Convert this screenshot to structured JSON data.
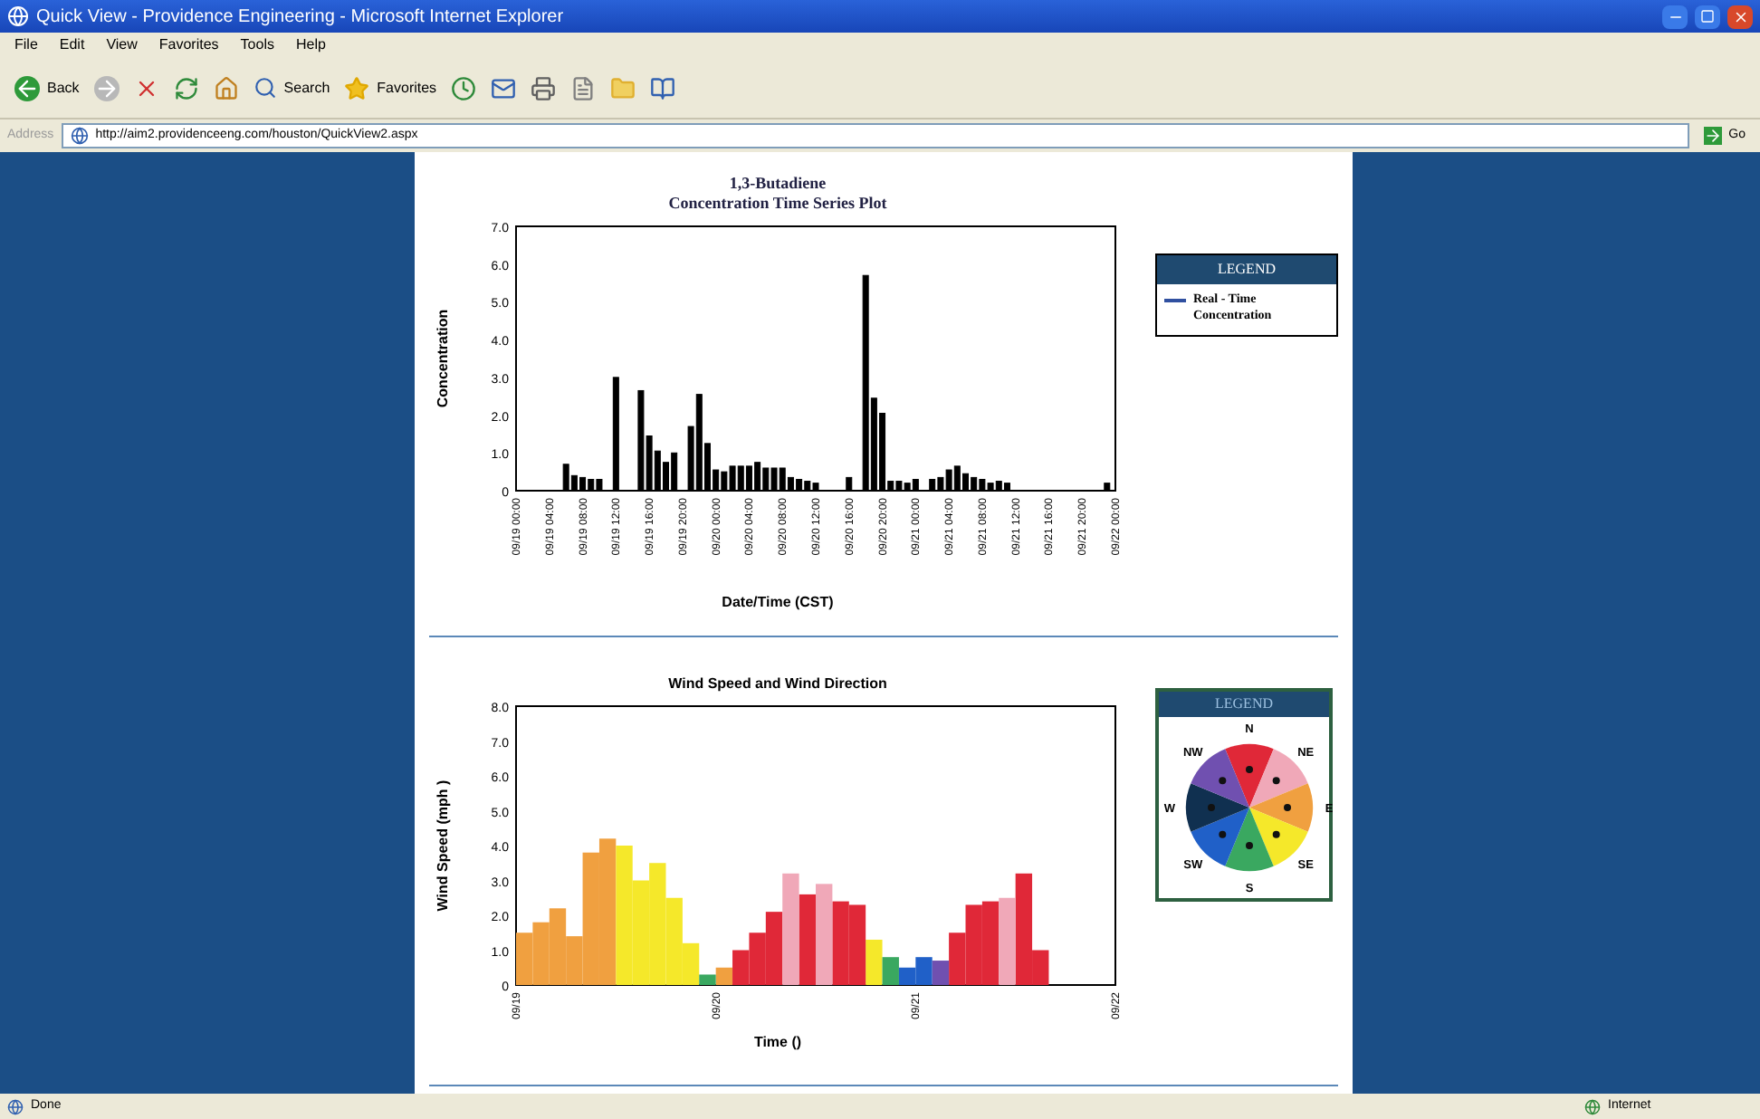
{
  "window": {
    "title": "Quick View - Providence Engineering - Microsoft Internet Explorer"
  },
  "menu": [
    "File",
    "Edit",
    "View",
    "Favorites",
    "Tools",
    "Help"
  ],
  "toolbar": {
    "back": "Back",
    "search": "Search",
    "favorites": "Favorites"
  },
  "address_bar": {
    "label": "Address",
    "value": "http://aim2.providenceeng.com/houston/QuickView2.aspx",
    "go": "Go"
  },
  "concentration_plot": {
    "title": "1,3-Butadiene",
    "subtitle": "Concentration Time Series Plot",
    "legend": {
      "header": "LEGEND",
      "items": [
        {
          "label": "Real - Time Concentration",
          "color": "#3050a0"
        }
      ]
    },
    "chart_data": {
      "type": "bar",
      "xlabel": "Date/Time (CST)",
      "ylabel": "Concentration",
      "categories": [
        "09/19 00:00",
        null,
        null,
        null,
        "09/19 04:00",
        null,
        null,
        null,
        "09/19 08:00",
        null,
        null,
        null,
        "09/19 12:00",
        null,
        null,
        null,
        "09/19 16:00",
        null,
        null,
        null,
        "09/19 20:00",
        null,
        null,
        null,
        "09/20 00:00",
        null,
        null,
        null,
        "09/20 04:00",
        null,
        null,
        null,
        "09/20 08:00",
        null,
        null,
        null,
        "09/20 12:00",
        null,
        null,
        null,
        "09/20 16:00",
        null,
        null,
        null,
        "09/20 20:00",
        null,
        null,
        null,
        "09/21 00:00",
        null,
        null,
        null,
        "09/21 04:00",
        null,
        null,
        null,
        "09/21 08:00",
        null,
        null,
        null,
        "09/21 12:00",
        null,
        null,
        null,
        "09/21 16:00",
        null,
        null,
        null,
        "09/21 20:00",
        null,
        null,
        null,
        "09/22 00:00"
      ],
      "values": [
        null,
        null,
        null,
        null,
        null,
        null,
        0.7,
        0.4,
        0.35,
        0.3,
        0.3,
        null,
        3.0,
        null,
        null,
        2.65,
        1.45,
        1.05,
        0.75,
        1.0,
        null,
        1.7,
        2.55,
        1.25,
        0.55,
        0.5,
        0.65,
        0.65,
        0.65,
        0.75,
        0.6,
        0.6,
        0.6,
        0.35,
        0.3,
        0.25,
        0.2,
        null,
        null,
        null,
        0.35,
        null,
        5.7,
        2.45,
        2.05,
        0.25,
        0.25,
        0.2,
        0.3,
        null,
        0.3,
        0.35,
        0.55,
        0.65,
        0.45,
        0.35,
        0.3,
        0.2,
        0.25,
        0.2,
        null,
        null,
        null,
        null,
        null,
        null,
        null,
        null,
        null,
        null,
        null,
        0.2,
        null
      ],
      "ylim": [
        0,
        7
      ],
      "yticks": [
        {
          "value": 0,
          "label": "0"
        },
        {
          "value": 1,
          "label": "1.0"
        },
        {
          "value": 2,
          "label": "2.0"
        },
        {
          "value": 3,
          "label": "3.0"
        },
        {
          "value": 4,
          "label": "4.0"
        },
        {
          "value": 5,
          "label": "5.0"
        },
        {
          "value": 6,
          "label": "6.0"
        },
        {
          "value": 7,
          "label": "7.0"
        }
      ]
    }
  },
  "wind_plot": {
    "legend": {
      "header": "LEGEND",
      "directions": [
        {
          "label": "N",
          "color": "#e02838"
        },
        {
          "label": "NE",
          "color": "#f0a8b8"
        },
        {
          "label": "E",
          "color": "#f0a040"
        },
        {
          "label": "SE",
          "color": "#f5e82a"
        },
        {
          "label": "S",
          "color": "#3aa860"
        },
        {
          "label": "SW",
          "color": "#2060c8"
        },
        {
          "label": "W",
          "color": "#103050"
        },
        {
          "label": "NW",
          "color": "#7050b0"
        }
      ]
    },
    "chart_data": {
      "type": "bar",
      "title": "Wind Speed and Wind Direction",
      "xlabel": "Time ()",
      "ylabel": "Wind Speed (mph )",
      "categories": [
        "09/19",
        null,
        null,
        null,
        null,
        null,
        null,
        null,
        null,
        null,
        null,
        null,
        "09/20",
        null,
        null,
        null,
        null,
        null,
        null,
        null,
        null,
        null,
        null,
        null,
        "09/21",
        null,
        null,
        null,
        null,
        null,
        null,
        null,
        null,
        null,
        null,
        null,
        "09/22"
      ],
      "series": [
        {
          "color": "#f0a040",
          "values": [
            1.5,
            1.8,
            2.2,
            1.4,
            3.8,
            4.2,
            null,
            null,
            null,
            null,
            null,
            null,
            0.5,
            null,
            null,
            null,
            null,
            null,
            null,
            null,
            null,
            null,
            null,
            null,
            null,
            null,
            null,
            null,
            null,
            null,
            null,
            null,
            null,
            null,
            null,
            null,
            null
          ]
        },
        {
          "color": "#f5e82a",
          "values": [
            null,
            null,
            null,
            null,
            null,
            null,
            4.0,
            3.0,
            3.5,
            2.5,
            1.2,
            null,
            null,
            null,
            null,
            null,
            null,
            null,
            null,
            null,
            null,
            1.3,
            null,
            null,
            null,
            null,
            null,
            null,
            null,
            null,
            null,
            null,
            null,
            null,
            null,
            null,
            null
          ]
        },
        {
          "color": "#3aa860",
          "values": [
            null,
            null,
            null,
            null,
            null,
            null,
            null,
            null,
            null,
            null,
            null,
            0.3,
            null,
            null,
            null,
            null,
            null,
            null,
            null,
            null,
            null,
            null,
            0.8,
            null,
            null,
            null,
            null,
            null,
            null,
            null,
            null,
            null,
            null,
            null,
            null,
            null,
            null
          ]
        },
        {
          "color": "#e02838",
          "values": [
            null,
            null,
            null,
            null,
            null,
            null,
            null,
            null,
            null,
            null,
            null,
            null,
            null,
            1.0,
            1.5,
            2.1,
            null,
            2.6,
            null,
            2.4,
            2.3,
            null,
            null,
            null,
            null,
            null,
            1.5,
            2.3,
            2.4,
            null,
            3.2,
            1.0,
            null,
            null,
            null,
            null,
            null
          ]
        },
        {
          "color": "#f0a8b8",
          "values": [
            null,
            null,
            null,
            null,
            null,
            null,
            null,
            null,
            null,
            null,
            null,
            null,
            null,
            null,
            null,
            null,
            3.2,
            null,
            2.9,
            null,
            null,
            null,
            null,
            null,
            null,
            null,
            null,
            null,
            null,
            2.5,
            null,
            null,
            null,
            null,
            null,
            null,
            null
          ]
        },
        {
          "color": "#2060c8",
          "values": [
            null,
            null,
            null,
            null,
            null,
            null,
            null,
            null,
            null,
            null,
            null,
            null,
            null,
            null,
            null,
            null,
            null,
            null,
            null,
            null,
            null,
            null,
            null,
            0.5,
            0.8,
            null,
            null,
            null,
            null,
            null,
            null,
            null,
            null,
            null,
            null,
            null,
            null
          ]
        },
        {
          "color": "#7050b0",
          "values": [
            null,
            null,
            null,
            null,
            null,
            null,
            null,
            null,
            null,
            null,
            null,
            null,
            null,
            null,
            null,
            null,
            null,
            null,
            null,
            null,
            null,
            null,
            null,
            null,
            null,
            0.7,
            null,
            null,
            null,
            null,
            null,
            null,
            null,
            null,
            null,
            null,
            null
          ]
        }
      ],
      "ylim": [
        0,
        8
      ],
      "yticks": [
        {
          "value": 0,
          "label": "0"
        },
        {
          "value": 1,
          "label": "1.0"
        },
        {
          "value": 2,
          "label": "2.0"
        },
        {
          "value": 3,
          "label": "3.0"
        },
        {
          "value": 4,
          "label": "4.0"
        },
        {
          "value": 5,
          "label": "5.0"
        },
        {
          "value": 6,
          "label": "6.0"
        },
        {
          "value": 7,
          "label": "7.0"
        },
        {
          "value": 8,
          "label": "8.0"
        }
      ]
    }
  },
  "status_bar": {
    "status": "Done",
    "zone": "Internet"
  }
}
